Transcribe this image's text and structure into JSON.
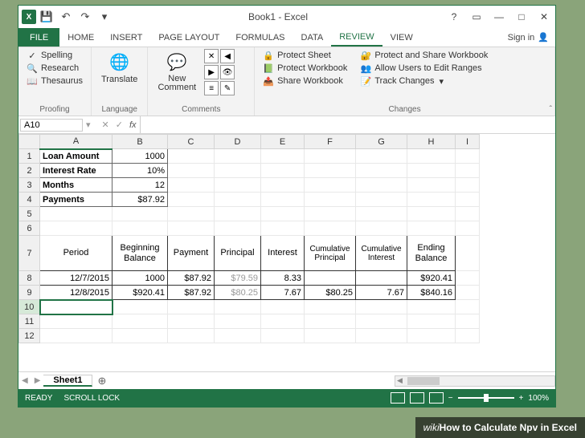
{
  "title": "Book1 - Excel",
  "tabs": {
    "file": "FILE",
    "home": "HOME",
    "insert": "INSERT",
    "pagelayout": "PAGE LAYOUT",
    "formulas": "FORMULAS",
    "data": "DATA",
    "review": "REVIEW",
    "view": "VIEW"
  },
  "signin": "Sign in",
  "ribbon": {
    "proofing": {
      "label": "Proofing",
      "spelling": "Spelling",
      "research": "Research",
      "thesaurus": "Thesaurus"
    },
    "language": {
      "label": "Language",
      "translate": "Translate"
    },
    "comments": {
      "label": "Comments",
      "newcomment": "New\nComment"
    },
    "changes": {
      "label": "Changes",
      "protectsheet": "Protect Sheet",
      "protectworkbook": "Protect Workbook",
      "shareworkbook": "Share Workbook",
      "protectshare": "Protect and Share Workbook",
      "allowusers": "Allow Users to Edit Ranges",
      "trackchanges": "Track Changes"
    }
  },
  "namebox": "A10",
  "columns": [
    "A",
    "B",
    "C",
    "D",
    "E",
    "F",
    "G",
    "H",
    "I"
  ],
  "rows": {
    "1": {
      "A": "Loan Amount",
      "B": "1000"
    },
    "2": {
      "A": "Interest Rate",
      "B": "10%"
    },
    "3": {
      "A": "Months",
      "B": "12"
    },
    "4": {
      "A": "Payments",
      "B": "$87.92"
    },
    "7": {
      "A": "Period",
      "B": "Beginning Balance",
      "C": "Payment",
      "D": "Principal",
      "E": "Interest",
      "F": "Cumulative Principal",
      "G": "Cumulative Interest",
      "H": "Ending Balance"
    },
    "8": {
      "A": "12/7/2015",
      "B": "1000",
      "C": "$87.92",
      "D": "$79.59",
      "E": "8.33",
      "F": "",
      "G": "",
      "H": "$920.41"
    },
    "9": {
      "A": "12/8/2015",
      "B": "$920.41",
      "C": "$87.92",
      "D": "$80.25",
      "E": "7.67",
      "F": "$80.25",
      "G": "7.67",
      "H": "$840.16"
    }
  },
  "sheet": "Sheet1",
  "status": {
    "ready": "READY",
    "scroll": "SCROLL LOCK",
    "zoom": "100%"
  },
  "caption": {
    "prefix": "wiki",
    "text": "How to Calculate Npv in Excel"
  },
  "chart_data": {
    "type": "table",
    "title": "Loan amortization inputs and schedule",
    "inputs": {
      "Loan Amount": 1000,
      "Interest Rate": "10%",
      "Months": 12,
      "Payments": 87.92
    },
    "schedule_columns": [
      "Period",
      "Beginning Balance",
      "Payment",
      "Principal",
      "Interest",
      "Cumulative Principal",
      "Cumulative Interest",
      "Ending Balance"
    ],
    "schedule": [
      {
        "Period": "12/7/2015",
        "Beginning Balance": 1000,
        "Payment": 87.92,
        "Principal": 79.59,
        "Interest": 8.33,
        "Cumulative Principal": null,
        "Cumulative Interest": null,
        "Ending Balance": 920.41
      },
      {
        "Period": "12/8/2015",
        "Beginning Balance": 920.41,
        "Payment": 87.92,
        "Principal": 80.25,
        "Interest": 7.67,
        "Cumulative Principal": 80.25,
        "Cumulative Interest": 7.67,
        "Ending Balance": 840.16
      }
    ]
  }
}
